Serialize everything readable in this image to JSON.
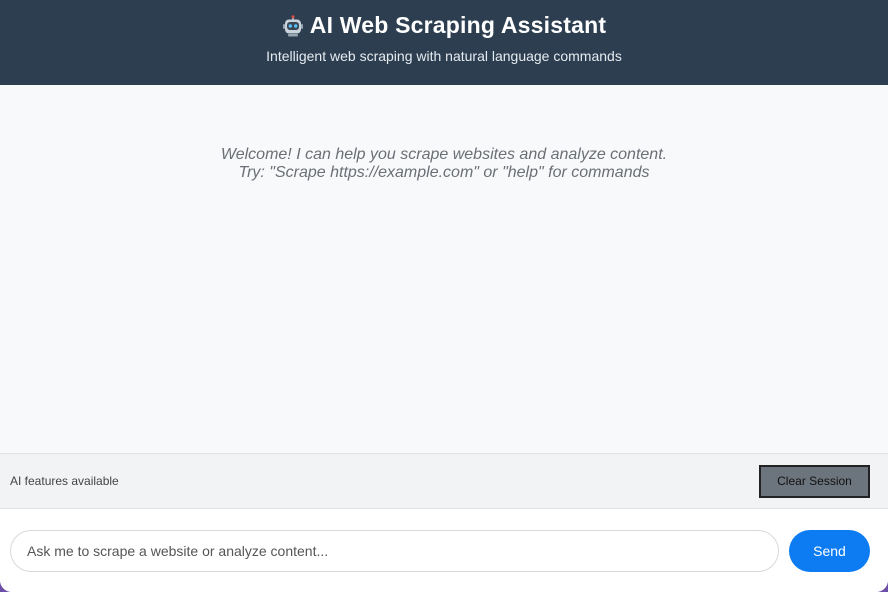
{
  "header": {
    "icon": "robot-icon",
    "title": "AI Web Scraping Assistant",
    "subtitle": "Intelligent web scraping with natural language commands"
  },
  "messages": {
    "welcome_line1": "Welcome! I can help you scrape websites and analyze content.",
    "welcome_line2": "Try: \"Scrape https://example.com\" or \"help\" for commands"
  },
  "status": {
    "text": "AI features available",
    "clear_label": "Clear Session"
  },
  "input": {
    "placeholder": "Ask me to scrape a website or analyze content...",
    "value": "",
    "send_label": "Send"
  },
  "colors": {
    "header_bg": "#2c3e50",
    "send_button": "#0d7cf2",
    "clear_button": "#6c757d"
  }
}
